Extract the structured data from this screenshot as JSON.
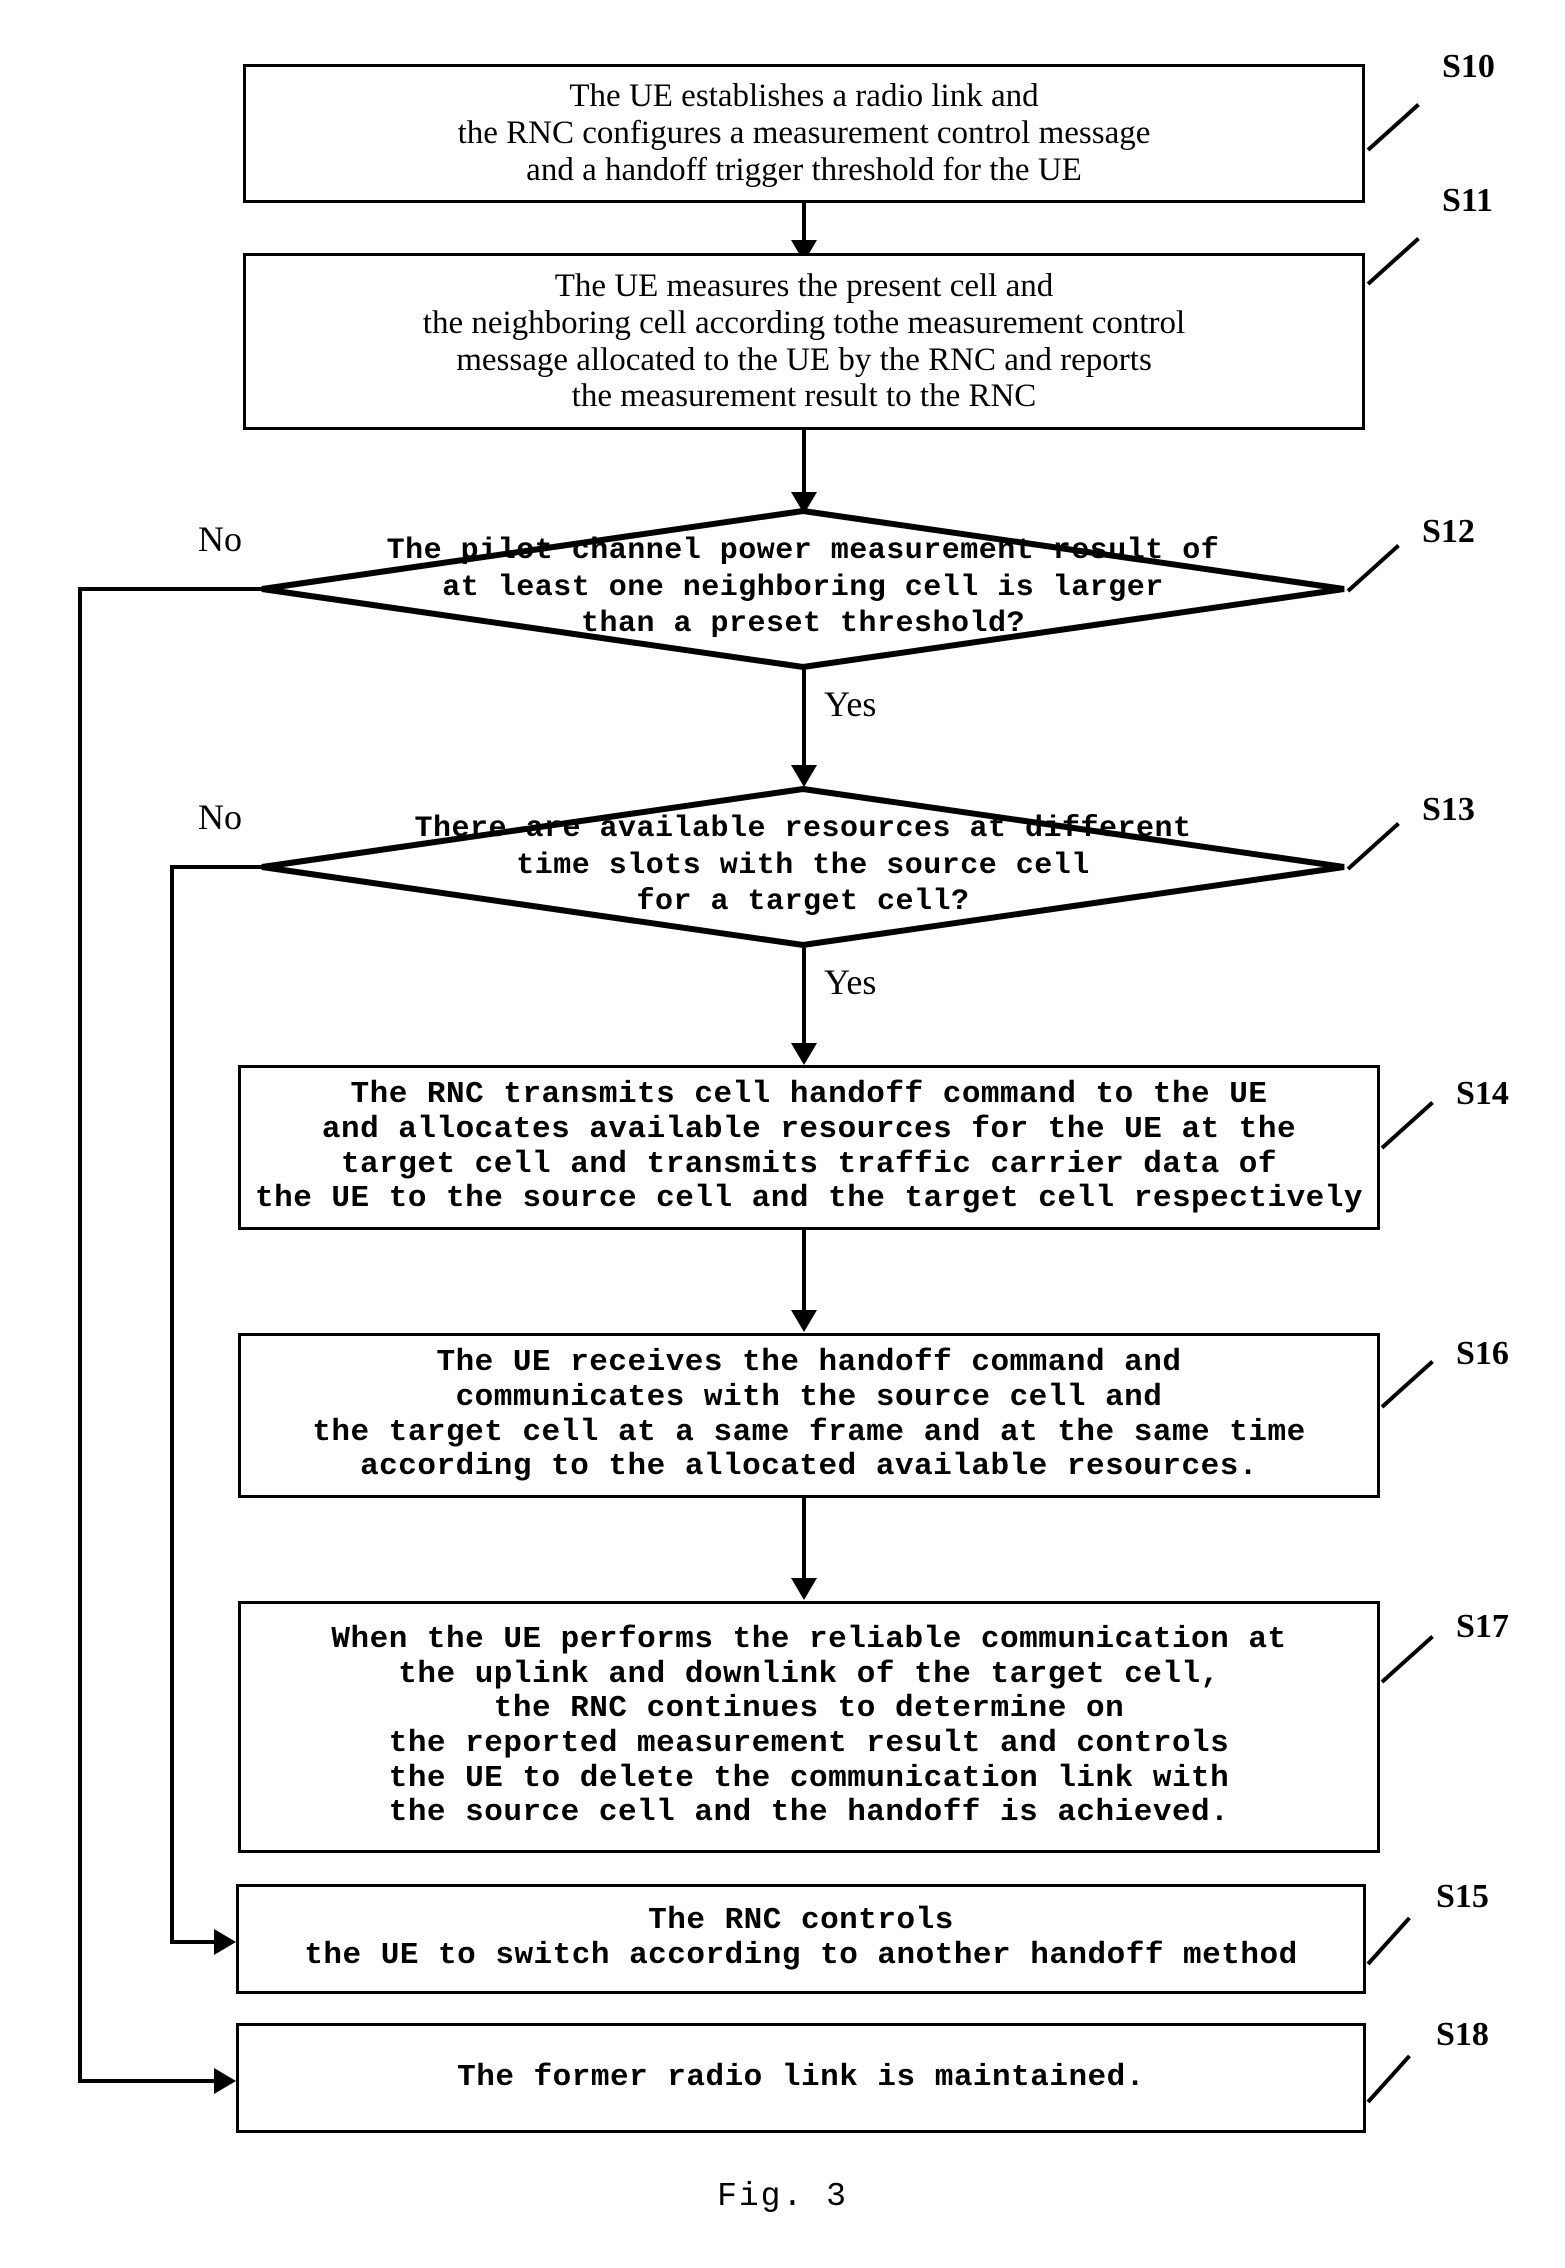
{
  "figure": {
    "caption": "Fig. 3",
    "branch_yes": "Yes",
    "branch_no": "No"
  },
  "steps": [
    {
      "id": "S10",
      "tag": "S10",
      "kind": "process",
      "text": "The UE establishes a radio link and\nthe RNC configures a measurement control message\nand a handoff trigger threshold for the UE"
    },
    {
      "id": "S11",
      "tag": "S11",
      "kind": "process",
      "text": "The UE measures the present cell and\nthe neighboring cell according tothe measurement control\nmessage allocated to the UE by the RNC and reports\nthe measurement result to the RNC"
    },
    {
      "id": "S12",
      "tag": "S12",
      "kind": "decision",
      "text": "The pilot channel power measurement result of\nat least one neighboring cell is larger\nthan a preset threshold?"
    },
    {
      "id": "S13",
      "tag": "S13",
      "kind": "decision",
      "text": "There are available resources at different\ntime slots with the source cell\nfor a target cell?"
    },
    {
      "id": "S14",
      "tag": "S14",
      "kind": "process",
      "text": "The RNC transmits cell handoff command to the UE\nand allocates available resources for the UE at the\ntarget cell and transmits traffic carrier data of\nthe UE to the source cell and the target cell respectively"
    },
    {
      "id": "S16",
      "tag": "S16",
      "kind": "process",
      "text": "The UE receives the handoff command and\ncommunicates with the source cell and\nthe target cell at a same frame and at the same time\naccording to the allocated available resources."
    },
    {
      "id": "S17",
      "tag": "S17",
      "kind": "process",
      "text": "When the UE performs the reliable communication at\nthe uplink and downlink of the target cell,\nthe RNC continues to determine on\nthe reported measurement result and controls\nthe UE to delete the communication link with\nthe source cell and the handoff is achieved."
    },
    {
      "id": "S15",
      "tag": "S15",
      "kind": "process",
      "text": "The RNC controls\nthe UE to switch according to another handoff method"
    },
    {
      "id": "S18",
      "tag": "S18",
      "kind": "process",
      "text": "The former radio link is maintained."
    }
  ],
  "colors": {
    "stroke": "#000000",
    "background": "#ffffff"
  }
}
